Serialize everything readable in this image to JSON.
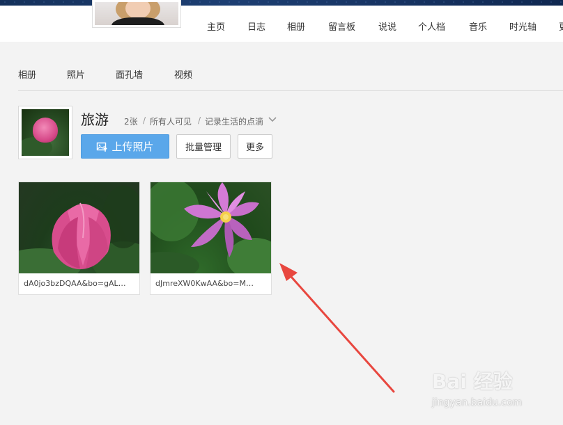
{
  "header": {
    "nav": [
      "主页",
      "日志",
      "相册",
      "留言板",
      "说说",
      "个人档",
      "音乐",
      "时光轴",
      "更"
    ]
  },
  "subnav": [
    "相册",
    "照片",
    "面孔墙",
    "视频"
  ],
  "album": {
    "title": "旅游",
    "count": "2张",
    "visibility": "所有人可见",
    "description": "记录生活的点滴",
    "separator": "/"
  },
  "buttons": {
    "upload": "上传照片",
    "batch": "批量管理",
    "more": "更多"
  },
  "photos": [
    {
      "caption": "dA0jo3bzDQAA&bo=gAL…"
    },
    {
      "caption": "dJmreXW0KwAA&bo=M…"
    }
  ],
  "watermark": {
    "logo": "Bai 经验",
    "site": "jingyan.baidu.com"
  },
  "colors": {
    "primary_button": "#5aa7ea",
    "arrow": "#e8473f"
  }
}
